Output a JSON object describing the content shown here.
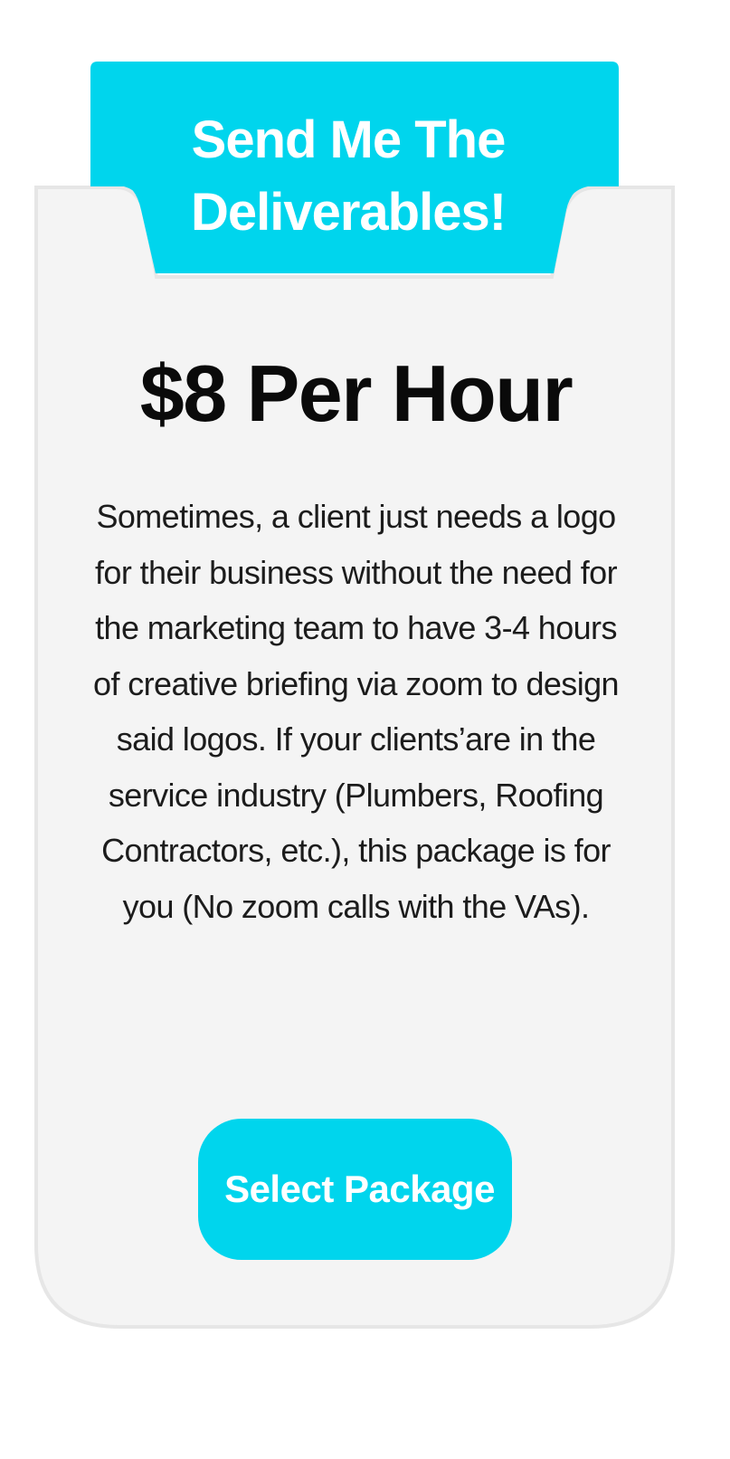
{
  "card": {
    "tab_title_line1": "Send Me The",
    "tab_title_line2": "Deliverables!",
    "price": "$8 Per Hour",
    "description": "Sometimes, a client just needs a logo for their business without the need for the marketing team to have 3-4 hours of creative briefing via zoom to design said logos. If your clients’are in the service industry (Plumbers, Roofing Contractors, etc.), this package is for you (No zoom calls with the VAs).",
    "button_label": "Select Package"
  },
  "colors": {
    "accent": "#00d5ed",
    "card_background": "#f4f4f4",
    "card_border": "#e6e6e6",
    "heading_text": "#0a0a0a",
    "body_text": "#1c1c1c",
    "button_text": "#ffffff"
  }
}
